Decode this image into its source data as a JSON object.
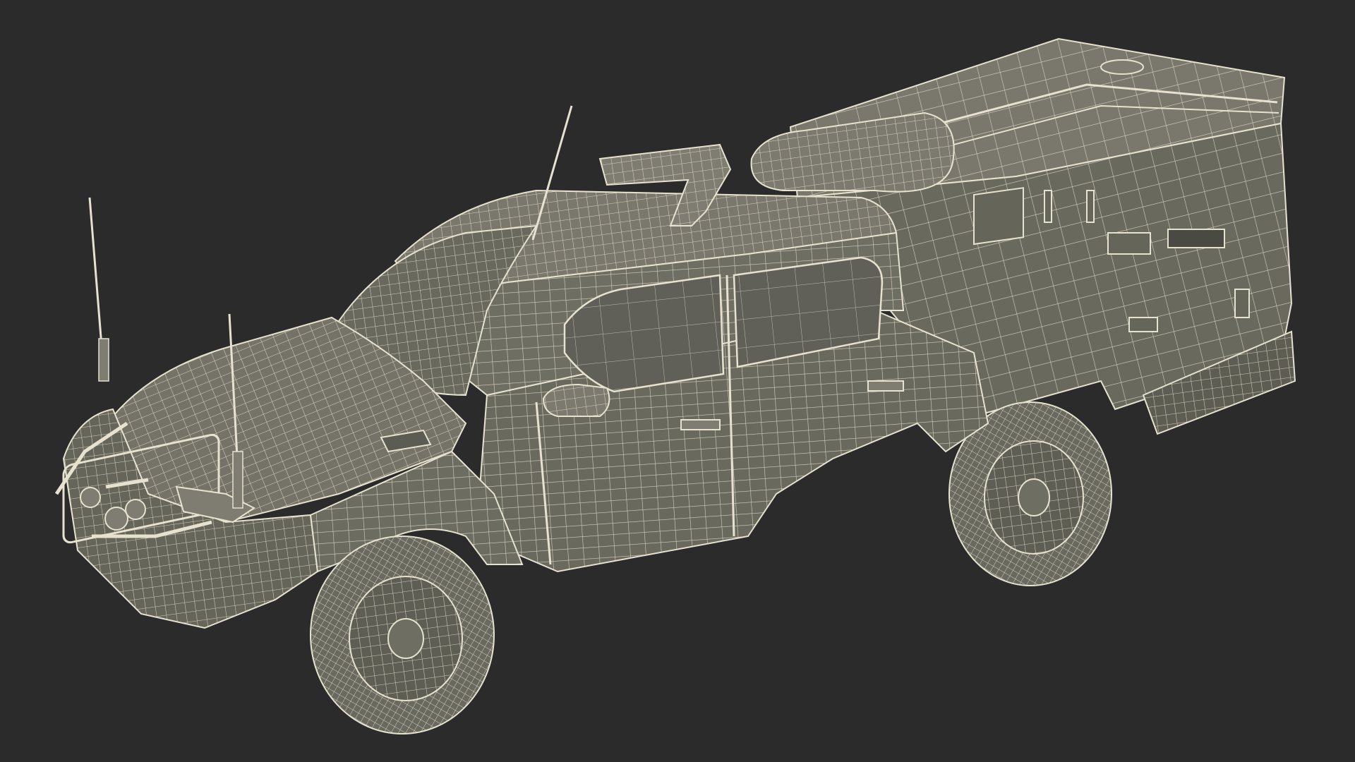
{
  "scene": {
    "subject": "wireframe-pickup-truck-with-canopy",
    "icon": "vehicle-wireframe-icon",
    "colors": {
      "background": "#2b2b2b",
      "surface": "#6f6e63",
      "surface_dark": "#5d5c52",
      "surface_light": "#7f7d71",
      "wire": "#e6e2cf",
      "tire": "#6a695f",
      "window": "#616058"
    }
  }
}
